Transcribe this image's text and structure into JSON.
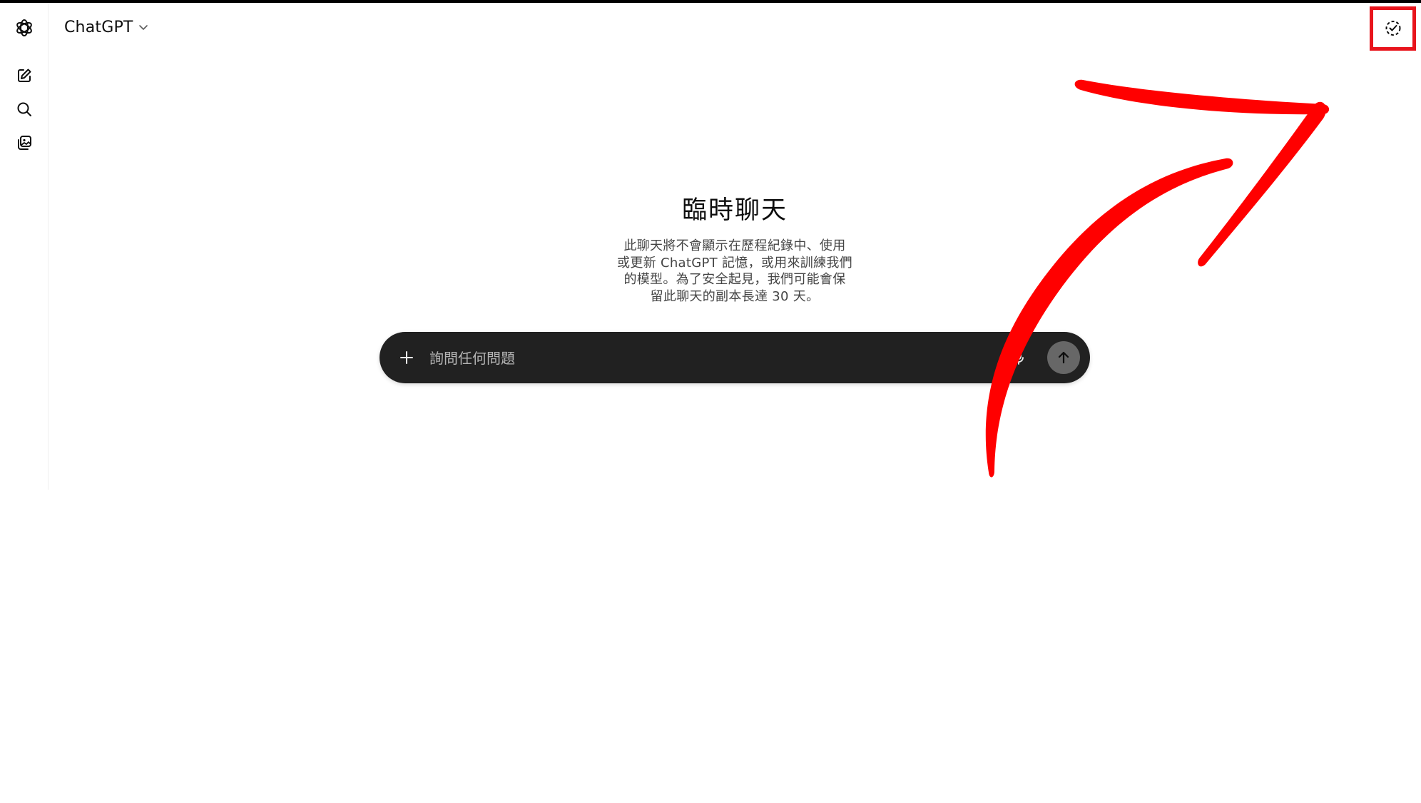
{
  "header": {
    "model_name": "ChatGPT"
  },
  "rail": {
    "items": [
      {
        "name": "new-chat",
        "icon": "edit-icon"
      },
      {
        "name": "search-chats",
        "icon": "search-icon"
      },
      {
        "name": "library",
        "icon": "images-icon"
      }
    ]
  },
  "temporary_chat": {
    "icon": "dashed-check-chat-icon",
    "highlight_color": "#e8141c"
  },
  "main": {
    "title": "臨時聊天",
    "notice_lines": [
      "此聊天將不會顯示在歷程紀錄中、使用",
      "或更新 ChatGPT 記憶，或用來訓練我們",
      "的模型。為了安全起見，我們可能會保",
      "留此聊天的副本長達 30 天。"
    ]
  },
  "composer": {
    "placeholder": "詢問任何問題",
    "background": "#212121",
    "send_button_color": "#676767"
  },
  "annotation": {
    "arrow_color": "#ff0000"
  }
}
